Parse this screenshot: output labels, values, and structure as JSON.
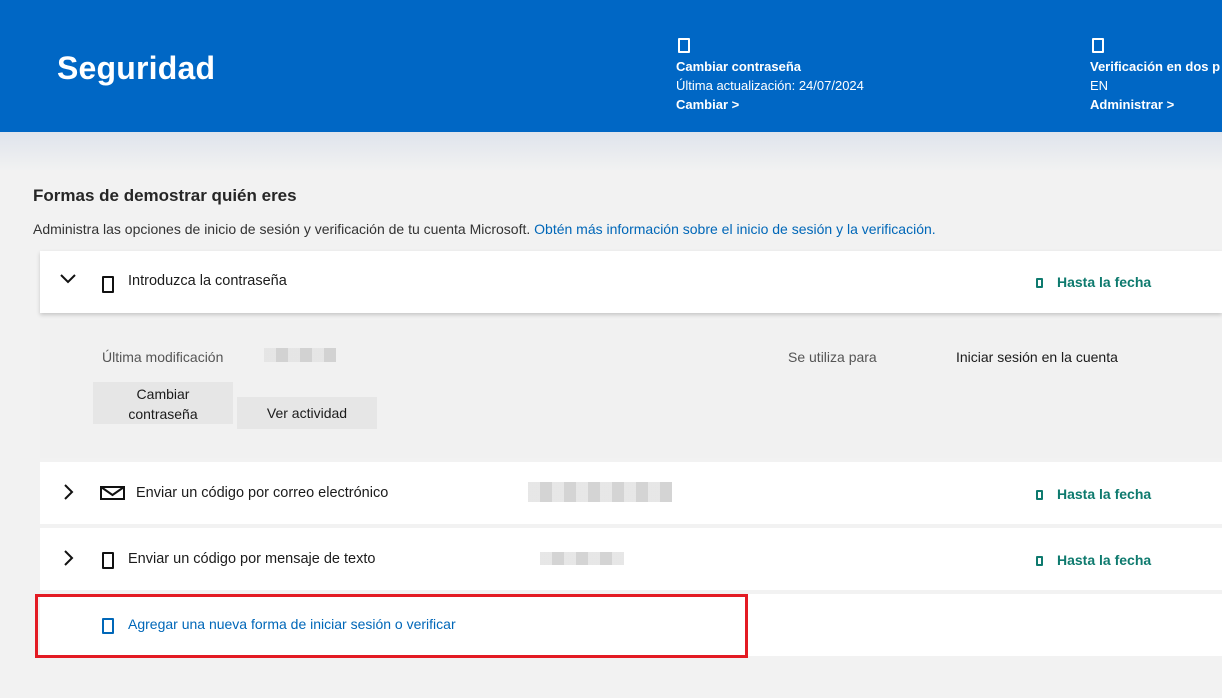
{
  "header": {
    "title": "Seguridad",
    "cards": [
      {
        "icon": "phone-icon",
        "title": "Cambiar contraseña",
        "line": "Última actualización: 24/07/2024",
        "link": "Cambiar >"
      },
      {
        "icon": "phone-icon",
        "title": "Verificación en dos p",
        "line": "EN",
        "link": "Administrar >"
      }
    ]
  },
  "section": {
    "title": "Formas de demostrar quién eres",
    "description": "Administra las opciones de inicio de sesión y verificación de tu cuenta Microsoft.",
    "learn_more": "Obtén más información sobre el inicio de sesión y la verificación."
  },
  "methods": [
    {
      "label": "Introduzca la contraseña",
      "status": "Hasta la fecha",
      "expanded": true,
      "icon": "phone-icon"
    },
    {
      "label": "Enviar un código por correo electrónico",
      "status": "Hasta la fecha",
      "expanded": false,
      "icon": "mail-icon"
    },
    {
      "label": "Enviar un código por mensaje de texto",
      "status": "Hasta la fecha",
      "expanded": false,
      "icon": "phone-icon"
    }
  ],
  "details": {
    "last_modified_label": "Última modificación",
    "used_for_label": "Se utiliza para",
    "used_for_value": "Iniciar sesión en la cuenta",
    "change_button": "Cambiar contraseña",
    "activity_button": "Ver actividad"
  },
  "add_method": "Agregar una nueva forma de iniciar sesión o verificar",
  "colors": {
    "header_bg": "#0067c5",
    "status": "#0e7a6e",
    "link": "#0067b8",
    "highlight": "#e31b23"
  }
}
